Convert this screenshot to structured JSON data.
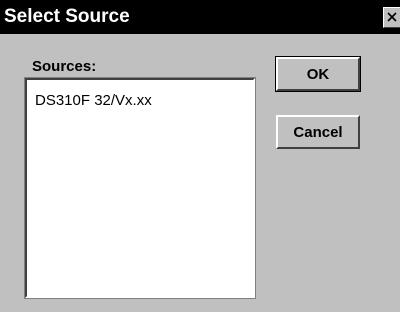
{
  "window": {
    "title": "Select Source",
    "close_icon": "close-icon"
  },
  "sources": {
    "label": "Sources:",
    "items": [
      "DS310F 32/Vx.xx"
    ]
  },
  "buttons": {
    "ok_label": "OK",
    "cancel_label": "Cancel"
  }
}
